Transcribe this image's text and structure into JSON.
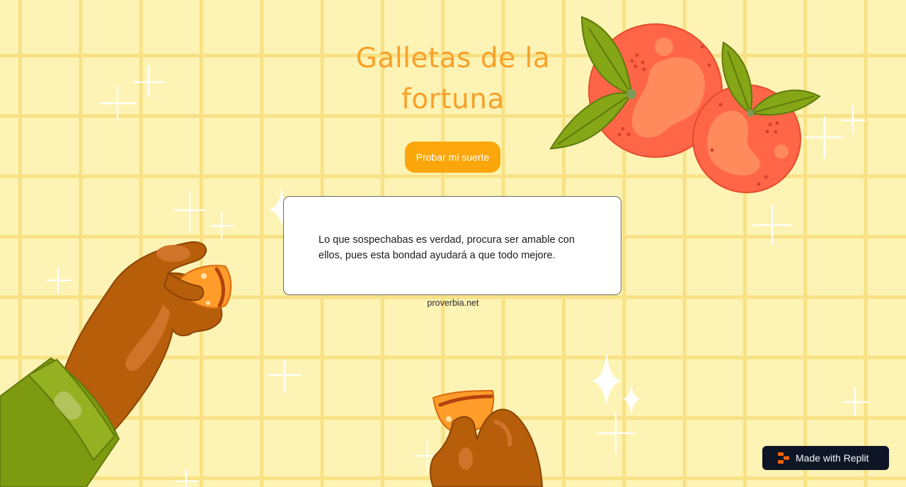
{
  "title": "Galletas de la fortuna",
  "button": {
    "label": "Probar mi suerte"
  },
  "fortune": {
    "text": "Lo que sospechabas es verdad, procura ser amable con ellos, pues esta bondad ayudará a que todo mejore.",
    "source": "proverbia.net"
  },
  "badge": {
    "label": "Made with Replit",
    "icon": "replit-logo-icon"
  },
  "colors": {
    "background": "#fdf3b4",
    "grid": "#f8e184",
    "title": "#f7a12a",
    "button": "#fba60a",
    "orange": "#ff6647",
    "leaf": "#7e9a10",
    "skin": "#b75e0b",
    "badge": "#0e1525"
  }
}
